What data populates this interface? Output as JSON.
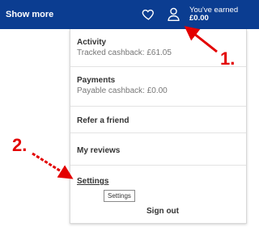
{
  "header": {
    "show_more_label": "Show more",
    "earned_label": "You've earned",
    "earned_amount": "£0.00",
    "icons": [
      "heart-icon",
      "user-icon"
    ],
    "bg_color": "#0b3d91"
  },
  "menu": {
    "items": [
      {
        "title": "Activity",
        "subtitle": "Tracked cashback: £61.05"
      },
      {
        "title": "Payments",
        "subtitle": "Payable cashback: £0.00"
      },
      {
        "title": "Refer a friend"
      },
      {
        "title": "My reviews"
      },
      {
        "title": "Settings"
      }
    ],
    "tooltip": "Settings",
    "sign_out_label": "Sign out"
  },
  "annotations": {
    "label_1": "1.",
    "label_2": "2.",
    "color": "#e30000"
  }
}
